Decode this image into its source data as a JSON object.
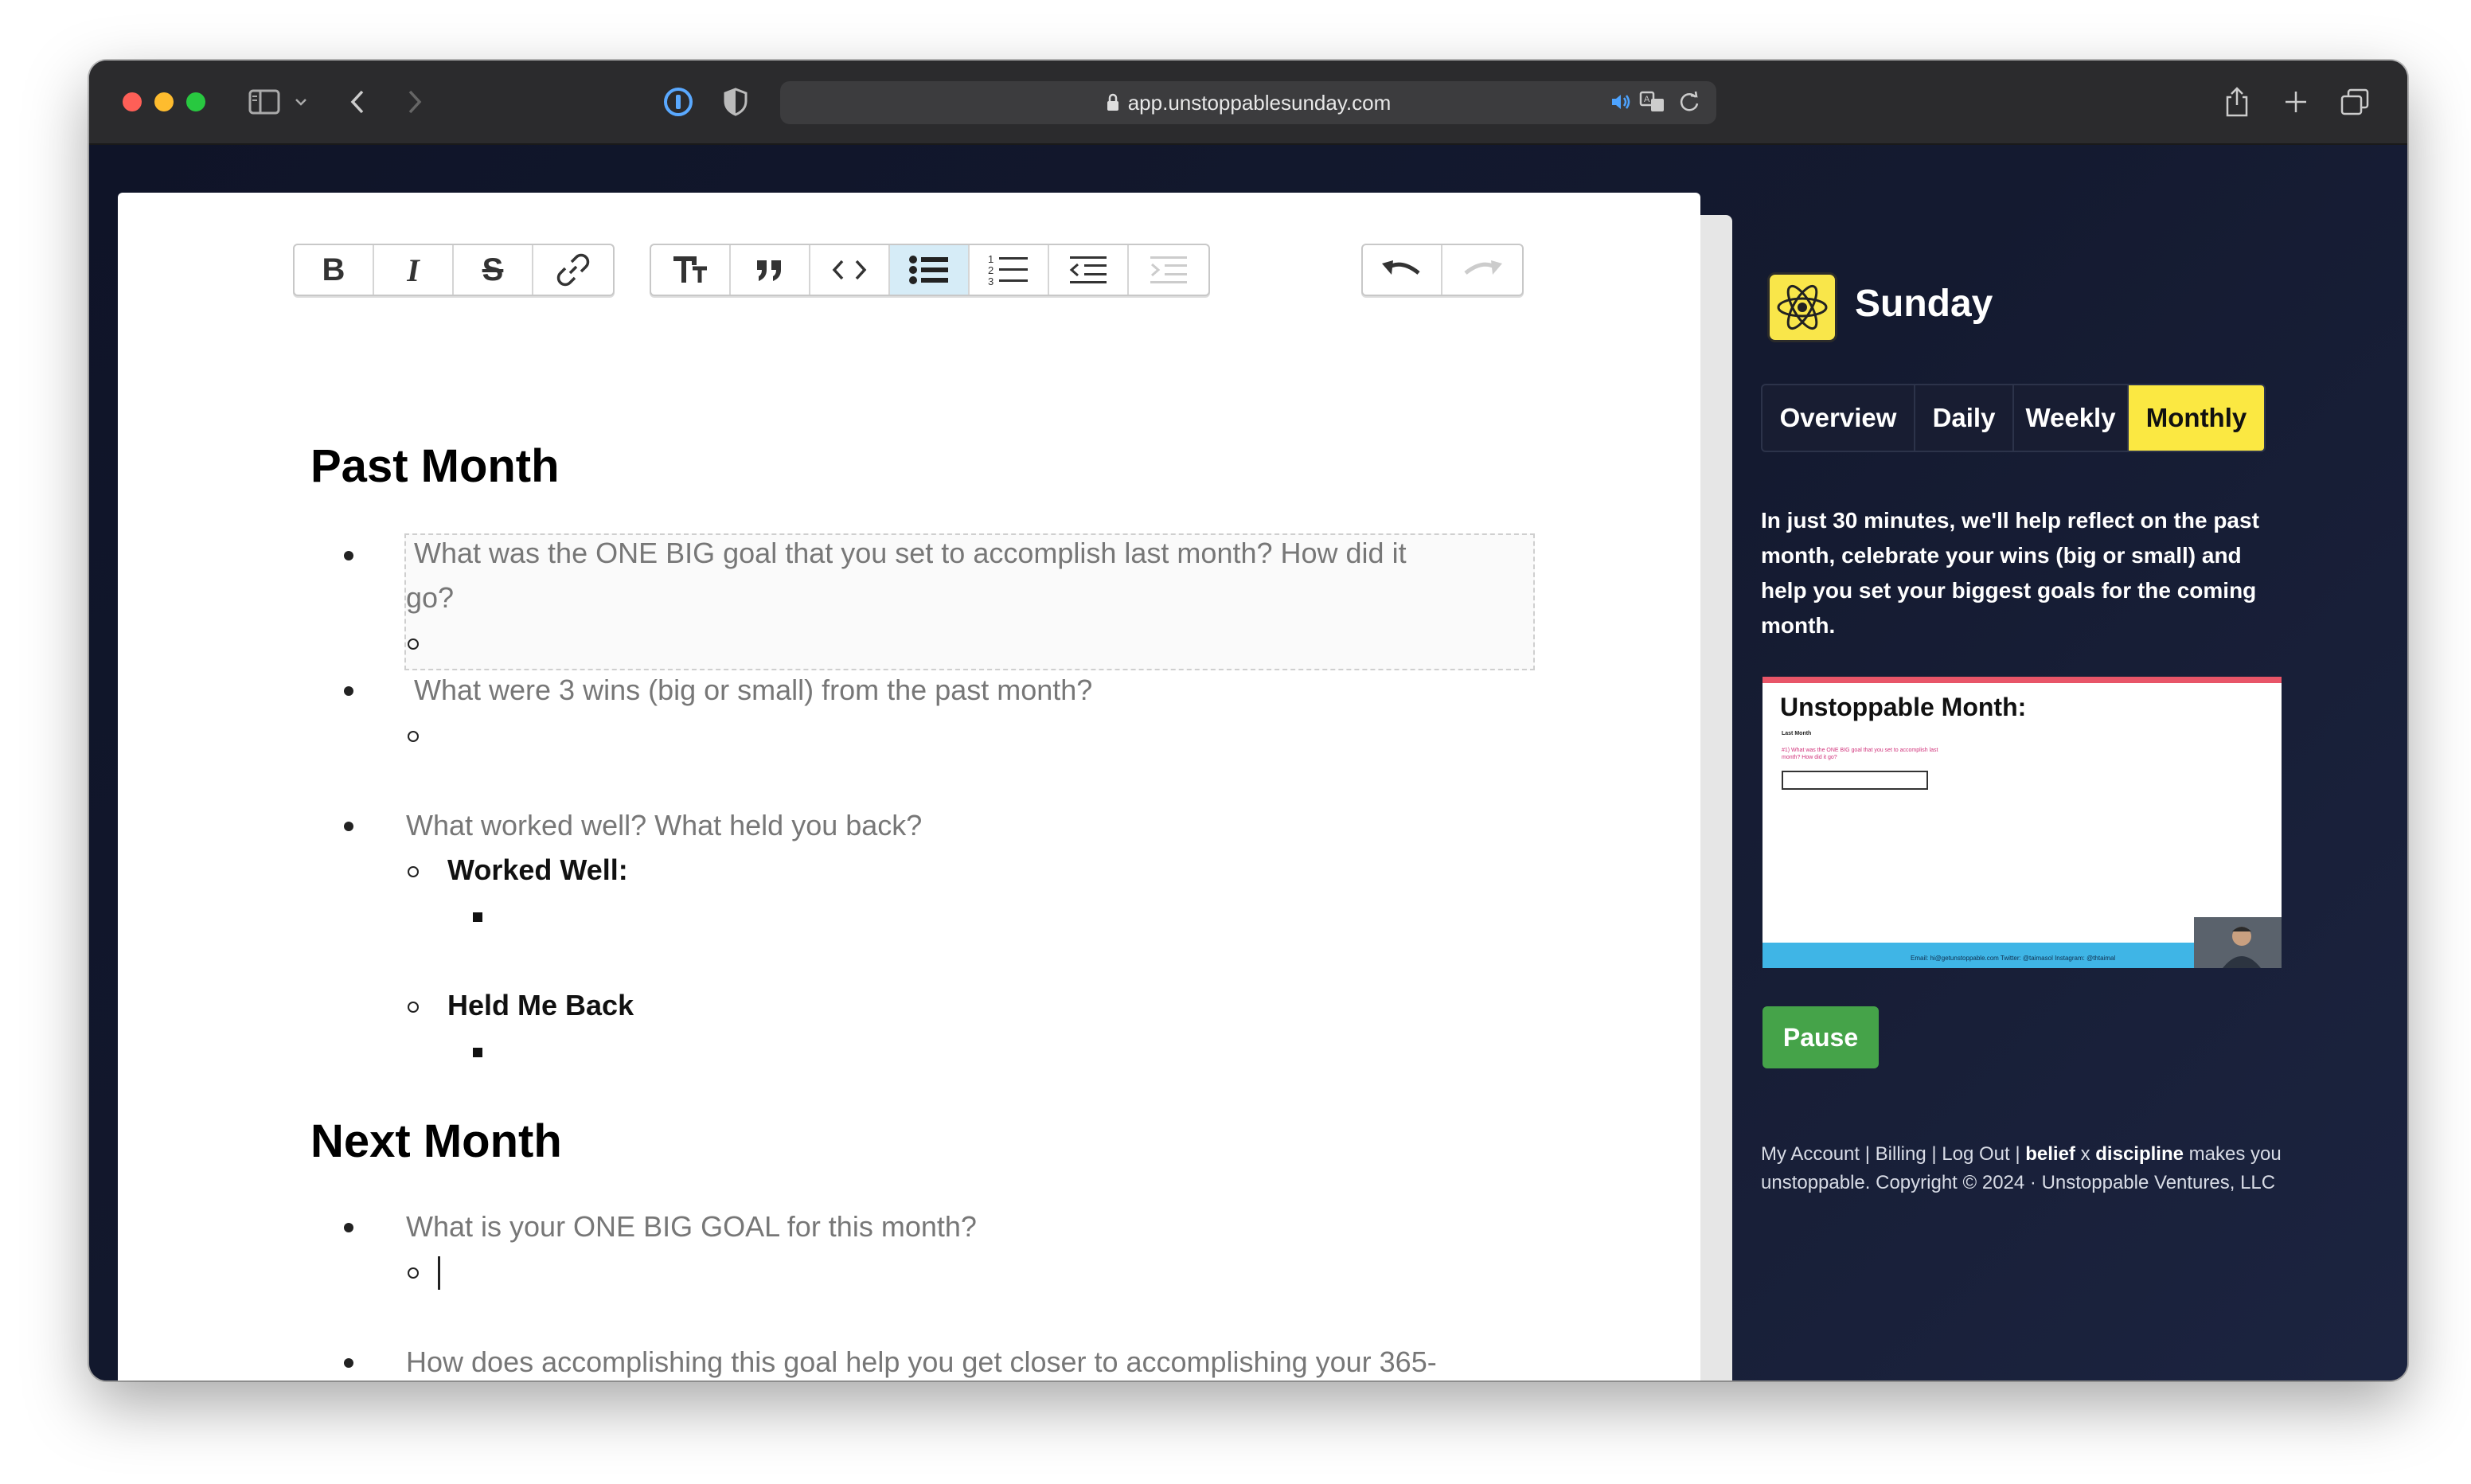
{
  "browser": {
    "url": "app.unstoppablesunday.com"
  },
  "toolbar": {
    "bold_label": "B",
    "italic_label": "I",
    "strike_label": "S"
  },
  "document": {
    "past_heading": "Past Month",
    "q1_line1": "What was the ONE BIG goal that you set to accomplish last month? How did it",
    "q1_line2": "go?",
    "q2": "What were 3 wins (big or small) from the past month?",
    "q3": "What worked well? What held you back?",
    "worked_well": "Worked Well:",
    "held_back": "Held Me Back",
    "next_heading": "Next Month",
    "q4": "What is your ONE BIG GOAL for this month?",
    "q5": "How does accomplishing this goal help you get closer to accomplishing your 365-"
  },
  "sidebar": {
    "app_name": "Sunday",
    "tabs": [
      {
        "label": "Overview"
      },
      {
        "label": "Daily"
      },
      {
        "label": "Weekly"
      },
      {
        "label": "Monthly"
      }
    ],
    "active_tab": "Monthly",
    "description": "In just 30 minutes, we'll help reflect on the past month, celebrate your wins (big or small) and help you set your biggest goals for the coming month.",
    "video": {
      "title": "Unstoppable Month:",
      "subtitle": "Last Month",
      "question": "#1) What was the ONE BIG goal that you set to accomplish last month? How did it go?",
      "footer": "Email: hi@getunstoppable.com   Twitter: @taimasol   Instagram: @thtaimal"
    },
    "pause_label": "Pause",
    "footer": {
      "my_account": "My Account",
      "billing": "Billing",
      "log_out": "Log Out",
      "sep": "|",
      "belief": "belief",
      "x": "x",
      "discipline": "discipline",
      "tagline_rest": "makes you unstoppable. Copyright © 2024 · Unstoppable Ventures, LLC"
    }
  },
  "colors": {
    "accent_yellow": "#fbe842",
    "pause_green": "#45a349",
    "sidebar_bg": "#141a2e",
    "active_toolbar": "#d6ecf7"
  }
}
